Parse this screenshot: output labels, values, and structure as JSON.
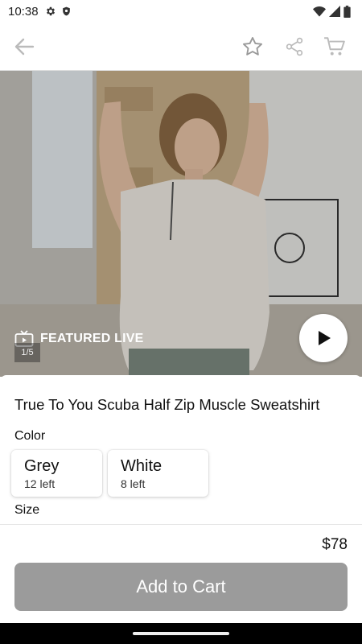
{
  "status_bar": {
    "time": "10:38",
    "icons": [
      "gear-icon",
      "shield-icon",
      "wifi-icon",
      "signal-icon",
      "battery-icon"
    ]
  },
  "app_bar": {
    "icons": [
      "back-arrow-icon",
      "star-icon",
      "share-icon",
      "cart-icon"
    ]
  },
  "hero": {
    "featured_label": "FEATURED LIVE",
    "image_counter": "1/5",
    "icons": [
      "tv-icon",
      "play-icon"
    ]
  },
  "product": {
    "title": "True To You Scuba Half Zip Muscle Sweatshirt",
    "price": "$78"
  },
  "color": {
    "label": "Color",
    "options": [
      {
        "name": "Grey",
        "stock": "12 left"
      },
      {
        "name": "White",
        "stock": "8 left"
      }
    ]
  },
  "size": {
    "label": "Size"
  },
  "actions": {
    "add_to_cart": "Add to Cart",
    "add_to_cart_color": "#9b9b9b"
  }
}
